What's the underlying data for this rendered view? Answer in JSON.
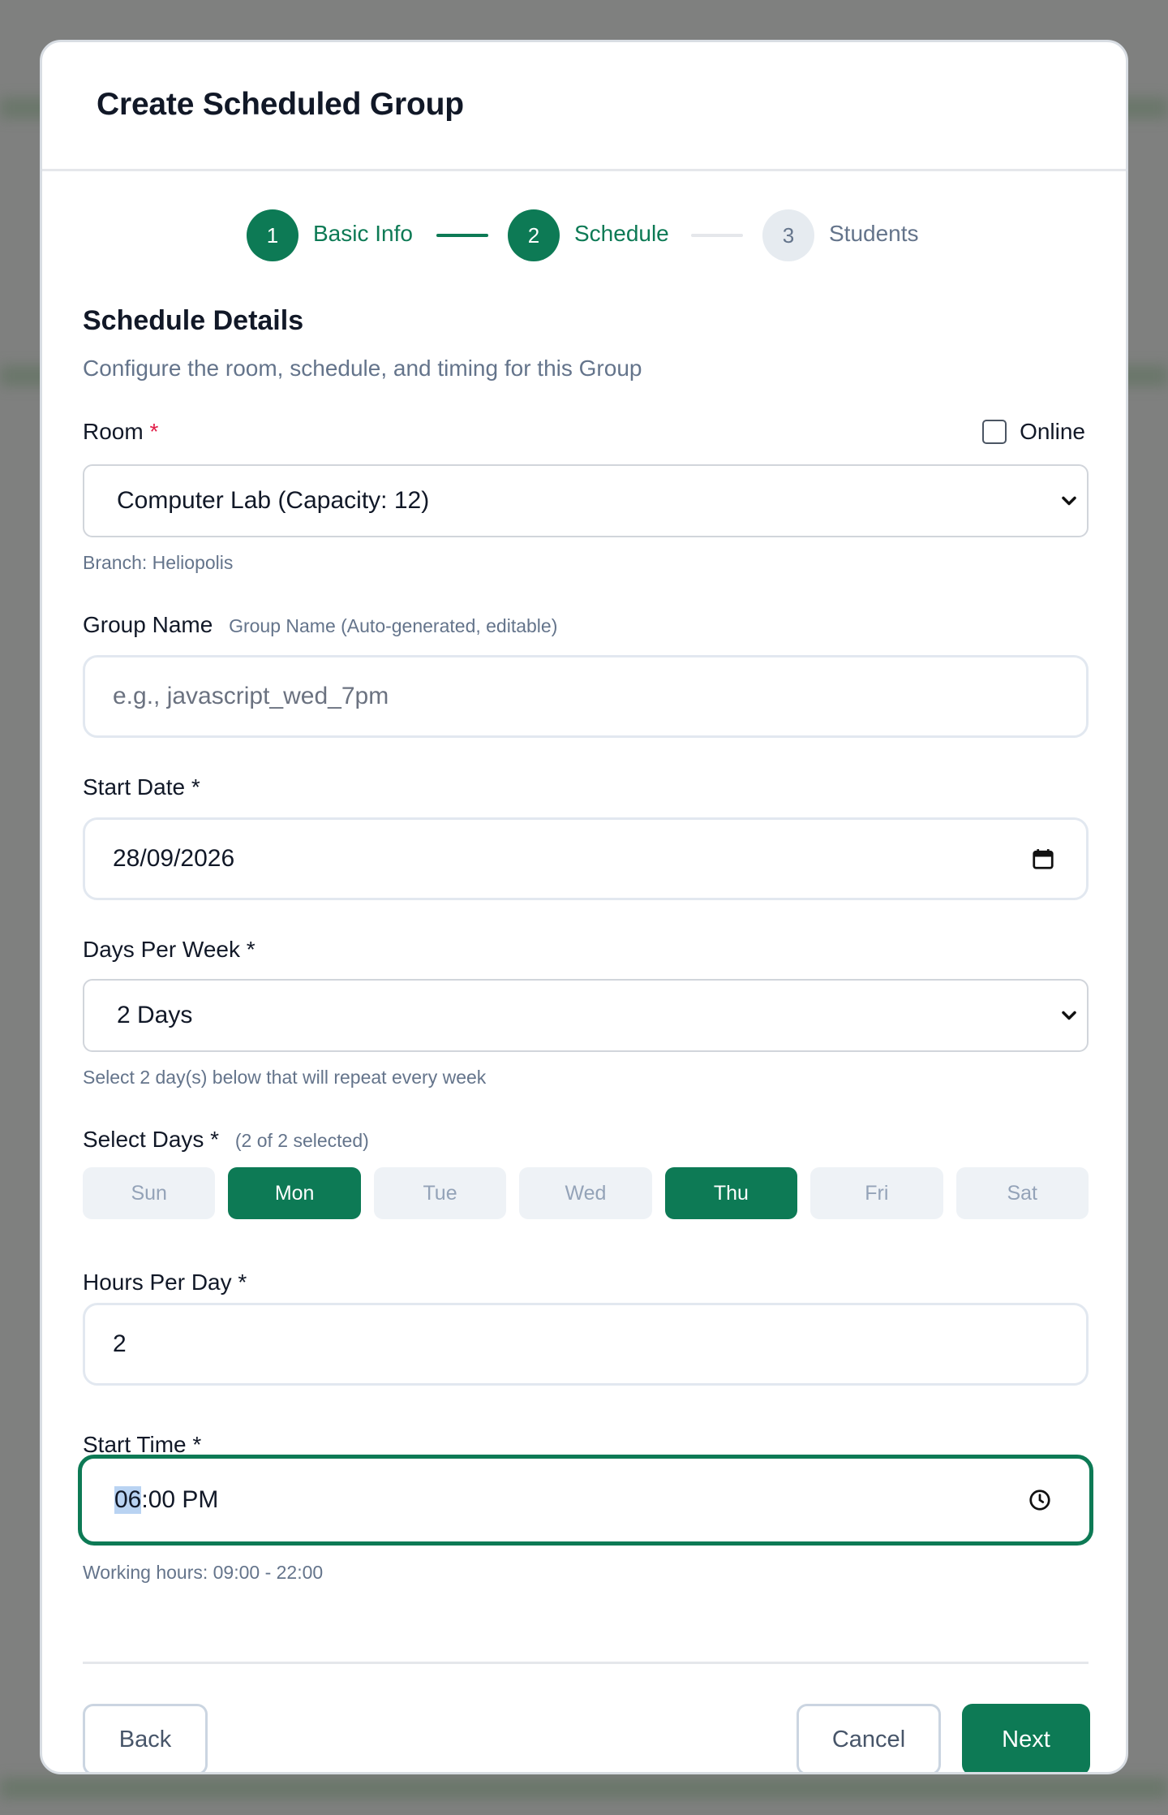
{
  "modal": {
    "title": "Create Scheduled Group"
  },
  "stepper": {
    "steps": [
      {
        "number": "1",
        "label": "Basic Info"
      },
      {
        "number": "2",
        "label": "Schedule"
      },
      {
        "number": "3",
        "label": "Students"
      }
    ]
  },
  "section": {
    "title": "Schedule Details",
    "subtitle": "Configure the room, schedule, and timing for this Group"
  },
  "room": {
    "label": "Room",
    "required_mark": "*",
    "online_label": "Online",
    "selected": "Computer Lab (Capacity: 12)",
    "branch_hint": "Branch: Heliopolis"
  },
  "group_name": {
    "label": "Group Name",
    "hint": "Group Name (Auto-generated, editable)",
    "placeholder": "e.g., javascript_wed_7pm"
  },
  "start_date": {
    "label": "Start Date *",
    "value": "28/09/2026"
  },
  "days_per_week": {
    "label": "Days Per Week *",
    "selected": "2 Days",
    "hint": "Select 2 day(s) below that will repeat every week"
  },
  "select_days": {
    "label": "Select Days *",
    "count_hint": "(2 of 2 selected)",
    "days": [
      {
        "label": "Sun",
        "selected": false
      },
      {
        "label": "Mon",
        "selected": true
      },
      {
        "label": "Tue",
        "selected": false
      },
      {
        "label": "Wed",
        "selected": false
      },
      {
        "label": "Thu",
        "selected": true
      },
      {
        "label": "Fri",
        "selected": false
      },
      {
        "label": "Sat",
        "selected": false
      }
    ]
  },
  "hours_per_day": {
    "label": "Hours Per Day *",
    "value": "2"
  },
  "start_time": {
    "label": "Start Time *",
    "hour": "06",
    "rest": ":00 PM",
    "hint": "Working hours: 09:00 - 22:00"
  },
  "footer": {
    "back": "Back",
    "cancel": "Cancel",
    "next": "Next"
  },
  "colors": {
    "primary": "#0d7a55",
    "muted": "#64748b",
    "required": "#e11d48"
  }
}
